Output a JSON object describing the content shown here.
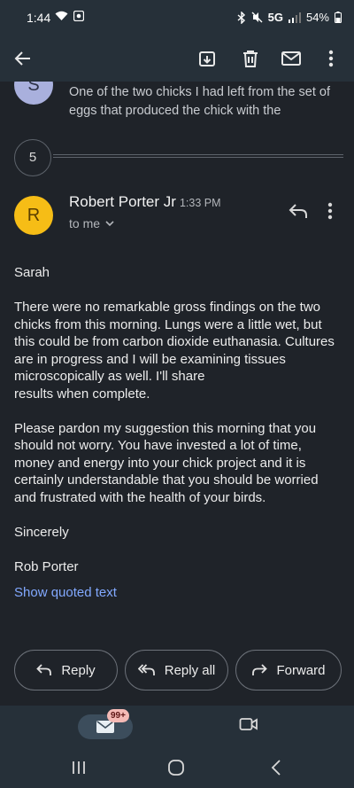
{
  "status_bar": {
    "time": "1:44",
    "network": "5G",
    "battery": "54%"
  },
  "app_bar": {
    "icons": [
      "back-arrow-icon",
      "archive-icon",
      "delete-icon",
      "mark-unread-icon",
      "more-vert-icon"
    ]
  },
  "thread": {
    "prev_message": {
      "avatar_letter": "S",
      "snippet": "One of the two chicks I had left from the set of eggs that produced the chick with the"
    },
    "collapsed_count": "5",
    "message": {
      "avatar_letter": "R",
      "sender": "Robert Porter Jr",
      "time": "1:33 PM",
      "recipient": "to me",
      "body": {
        "greeting": "Sarah",
        "paragraph1": "There were no remarkable gross findings on the two chicks from this morning.  Lungs were a little wet, but this could be from carbon dioxide euthanasia. Cultures are in progress and I will be examining tissues microscopically as well.  I'll share\nresults when complete.",
        "paragraph2": "Please pardon my suggestion this morning that you should not worry.  You have invested a lot of time, money and energy into your chick project and it is certainly understandable that you should be worried and frustrated with the health of your birds.",
        "closing": "Sincerely",
        "signature": "Rob Porter"
      },
      "show_quoted_label": "Show quoted text"
    }
  },
  "actions": {
    "reply": "Reply",
    "reply_all": "Reply all",
    "forward": "Forward"
  },
  "bottom_nav": {
    "mail_badge": "99+"
  },
  "colors": {
    "background": "#1f2329",
    "bar": "#263039",
    "avatar_r": "#f6bd16",
    "avatar_s": "#a9b0dd",
    "link": "#82a9ff"
  }
}
